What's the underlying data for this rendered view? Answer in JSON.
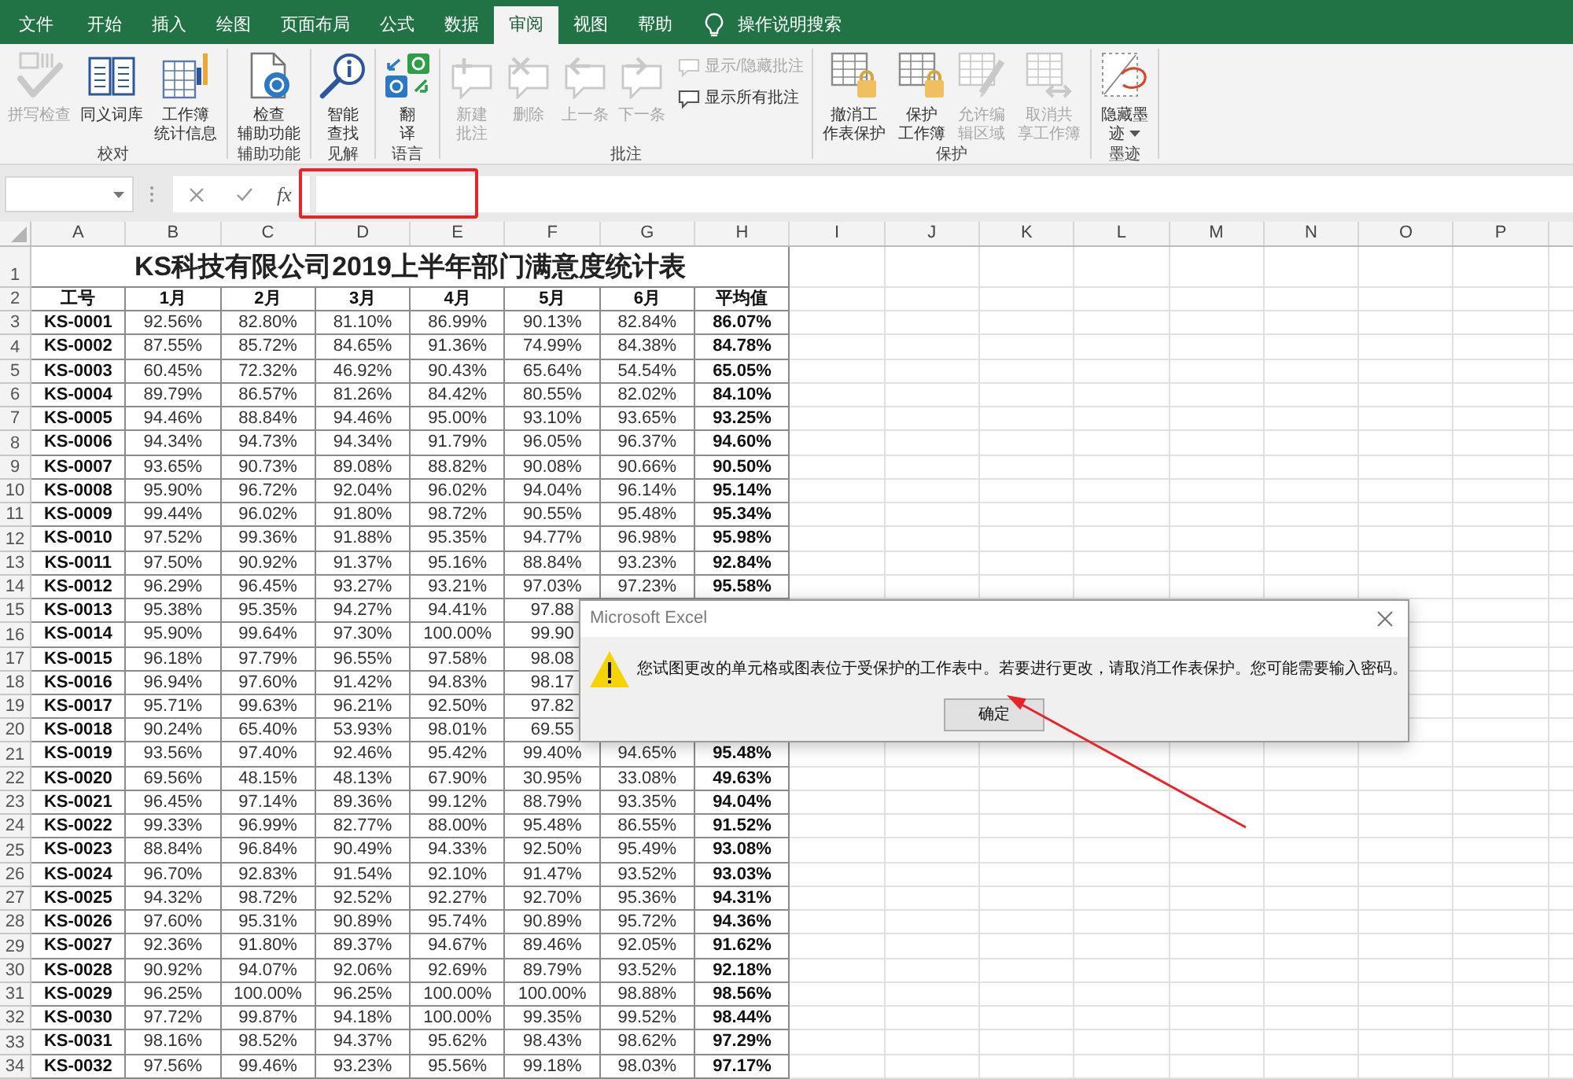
{
  "ribbon_tabs": [
    {
      "label": "文件",
      "selected": false
    },
    {
      "label": "开始",
      "selected": false
    },
    {
      "label": "插入",
      "selected": false
    },
    {
      "label": "绘图",
      "selected": false
    },
    {
      "label": "页面布局",
      "selected": false
    },
    {
      "label": "公式",
      "selected": false
    },
    {
      "label": "数据",
      "selected": false
    },
    {
      "label": "审阅",
      "selected": true
    },
    {
      "label": "视图",
      "selected": false
    },
    {
      "label": "帮助",
      "selected": false
    }
  ],
  "tell_me": {
    "label": "操作说明搜索"
  },
  "ribbon_groups": [
    {
      "label": "校对",
      "commands": [
        {
          "kind": "large",
          "label": "拼写检查",
          "disabled": true
        },
        {
          "kind": "large",
          "label": "同义词库",
          "disabled": false
        },
        {
          "kind": "large",
          "label": "工作簿统计信息",
          "disabled": false
        }
      ]
    },
    {
      "label": "辅助功能",
      "commands": [
        {
          "kind": "large",
          "label": "检查辅助功能",
          "disabled": false
        }
      ]
    },
    {
      "label": "见解",
      "commands": [
        {
          "kind": "large",
          "label": "智能查找",
          "disabled": false
        }
      ]
    },
    {
      "label": "语言",
      "commands": [
        {
          "kind": "large",
          "label": "翻译",
          "disabled": false
        }
      ]
    },
    {
      "label": "批注",
      "commands": [
        {
          "kind": "large",
          "label": "新建批注",
          "disabled": true
        },
        {
          "kind": "large",
          "label": "删除",
          "disabled": true
        },
        {
          "kind": "large",
          "label": "上一条",
          "disabled": true
        },
        {
          "kind": "large",
          "label": "下一条",
          "disabled": true
        },
        {
          "kind": "small",
          "label": "显示/隐藏批注",
          "disabled": true
        },
        {
          "kind": "small",
          "label": "显示所有批注",
          "disabled": false
        }
      ]
    },
    {
      "label": "保护",
      "commands": [
        {
          "kind": "large",
          "label": "撤消工作表保护",
          "disabled": false
        },
        {
          "kind": "large",
          "label": "保护工作簿",
          "disabled": false
        },
        {
          "kind": "large",
          "label": "允许编辑区域",
          "disabled": true
        },
        {
          "kind": "large",
          "label": "取消共享工作簿",
          "disabled": true
        }
      ]
    },
    {
      "label": "墨迹",
      "commands": [
        {
          "kind": "dropdown",
          "label": "隐藏墨迹",
          "disabled": false
        }
      ]
    }
  ],
  "formula_bar": {
    "function_label": "fx"
  },
  "sheet": {
    "columns": [
      "A",
      "B",
      "C",
      "D",
      "E",
      "F",
      "G",
      "H",
      "I",
      "J",
      "K",
      "L",
      "M",
      "N",
      "O",
      "P"
    ],
    "row_numbers": [
      "1",
      "2",
      "3",
      "4",
      "5",
      "6",
      "7",
      "8",
      "9",
      "10",
      "11",
      "12",
      "13",
      "14",
      "15",
      "16",
      "17",
      "18",
      "19",
      "20",
      "21",
      "22",
      "23",
      "24",
      "25",
      "26",
      "27",
      "28",
      "29",
      "30",
      "31",
      "32",
      "33",
      "34"
    ],
    "title": "KS科技有限公司2019上半年部门满意度统计表",
    "header": [
      "工号",
      "1月",
      "2月",
      "3月",
      "4月",
      "5月",
      "6月",
      "平均值"
    ],
    "rows": [
      [
        "KS-0001",
        "92.56%",
        "82.80%",
        "81.10%",
        "86.99%",
        "90.13%",
        "82.84%",
        "86.07%"
      ],
      [
        "KS-0002",
        "87.55%",
        "85.72%",
        "84.65%",
        "91.36%",
        "74.99%",
        "84.38%",
        "84.78%"
      ],
      [
        "KS-0003",
        "60.45%",
        "72.32%",
        "46.92%",
        "90.43%",
        "65.64%",
        "54.54%",
        "65.05%"
      ],
      [
        "KS-0004",
        "89.79%",
        "86.57%",
        "81.26%",
        "84.42%",
        "80.55%",
        "82.02%",
        "84.10%"
      ],
      [
        "KS-0005",
        "94.46%",
        "88.84%",
        "94.46%",
        "95.00%",
        "93.10%",
        "93.65%",
        "93.25%"
      ],
      [
        "KS-0006",
        "94.34%",
        "94.73%",
        "94.34%",
        "91.79%",
        "96.05%",
        "96.37%",
        "94.60%"
      ],
      [
        "KS-0007",
        "93.65%",
        "90.73%",
        "89.08%",
        "88.82%",
        "90.08%",
        "90.66%",
        "90.50%"
      ],
      [
        "KS-0008",
        "95.90%",
        "96.72%",
        "92.04%",
        "96.02%",
        "94.04%",
        "96.14%",
        "95.14%"
      ],
      [
        "KS-0009",
        "99.44%",
        "96.02%",
        "91.80%",
        "98.72%",
        "90.55%",
        "95.48%",
        "95.34%"
      ],
      [
        "KS-0010",
        "97.52%",
        "99.36%",
        "91.88%",
        "95.35%",
        "94.77%",
        "96.98%",
        "95.98%"
      ],
      [
        "KS-0011",
        "97.50%",
        "90.92%",
        "91.37%",
        "95.16%",
        "88.84%",
        "93.23%",
        "92.84%"
      ],
      [
        "KS-0012",
        "96.29%",
        "96.45%",
        "93.27%",
        "93.21%",
        "97.03%",
        "97.23%",
        "95.58%"
      ],
      [
        "KS-0013",
        "95.38%",
        "95.35%",
        "94.27%",
        "94.41%",
        "97.88"
      ],
      [
        "KS-0014",
        "95.90%",
        "99.64%",
        "97.30%",
        "100.00%",
        "99.90"
      ],
      [
        "KS-0015",
        "96.18%",
        "97.79%",
        "96.55%",
        "97.58%",
        "98.08"
      ],
      [
        "KS-0016",
        "96.94%",
        "97.60%",
        "91.42%",
        "94.83%",
        "98.17"
      ],
      [
        "KS-0017",
        "95.71%",
        "99.63%",
        "96.21%",
        "92.50%",
        "97.82"
      ],
      [
        "KS-0018",
        "90.24%",
        "65.40%",
        "53.93%",
        "98.01%",
        "69.55"
      ],
      [
        "KS-0019",
        "93.56%",
        "97.40%",
        "92.46%",
        "95.42%",
        "99.40%",
        "94.65%",
        "95.48%"
      ],
      [
        "KS-0020",
        "69.56%",
        "48.15%",
        "48.13%",
        "67.90%",
        "30.95%",
        "33.08%",
        "49.63%"
      ],
      [
        "KS-0021",
        "96.45%",
        "97.14%",
        "89.36%",
        "99.12%",
        "88.79%",
        "93.35%",
        "94.04%"
      ],
      [
        "KS-0022",
        "99.33%",
        "96.99%",
        "82.77%",
        "88.00%",
        "95.48%",
        "86.55%",
        "91.52%"
      ],
      [
        "KS-0023",
        "88.84%",
        "96.84%",
        "90.49%",
        "94.33%",
        "92.50%",
        "95.49%",
        "93.08%"
      ],
      [
        "KS-0024",
        "96.70%",
        "92.83%",
        "91.54%",
        "92.10%",
        "91.47%",
        "93.52%",
        "93.03%"
      ],
      [
        "KS-0025",
        "94.32%",
        "98.72%",
        "92.52%",
        "92.27%",
        "92.70%",
        "95.36%",
        "94.31%"
      ],
      [
        "KS-0026",
        "97.60%",
        "95.31%",
        "90.89%",
        "95.74%",
        "90.89%",
        "95.72%",
        "94.36%"
      ],
      [
        "KS-0027",
        "92.36%",
        "91.80%",
        "89.37%",
        "94.67%",
        "89.46%",
        "92.05%",
        "91.62%"
      ],
      [
        "KS-0028",
        "90.92%",
        "94.07%",
        "92.06%",
        "92.69%",
        "89.79%",
        "93.52%",
        "92.18%"
      ],
      [
        "KS-0029",
        "96.25%",
        "100.00%",
        "96.25%",
        "100.00%",
        "100.00%",
        "98.88%",
        "98.56%"
      ],
      [
        "KS-0030",
        "97.72%",
        "99.87%",
        "94.18%",
        "100.00%",
        "99.35%",
        "99.52%",
        "98.44%"
      ],
      [
        "KS-0031",
        "98.16%",
        "98.52%",
        "94.37%",
        "95.62%",
        "98.43%",
        "98.62%",
        "97.29%"
      ],
      [
        "KS-0032",
        "97.56%",
        "99.46%",
        "93.23%",
        "95.56%",
        "99.18%",
        "98.03%",
        "97.17%"
      ]
    ]
  },
  "dialog": {
    "title": "Microsoft Excel",
    "message": "您试图更改的单元格或图表位于受保护的工作表中。若要进行更改，请取消工作表保护。您可能需要输入密码。",
    "buttons": [
      "确定"
    ]
  }
}
